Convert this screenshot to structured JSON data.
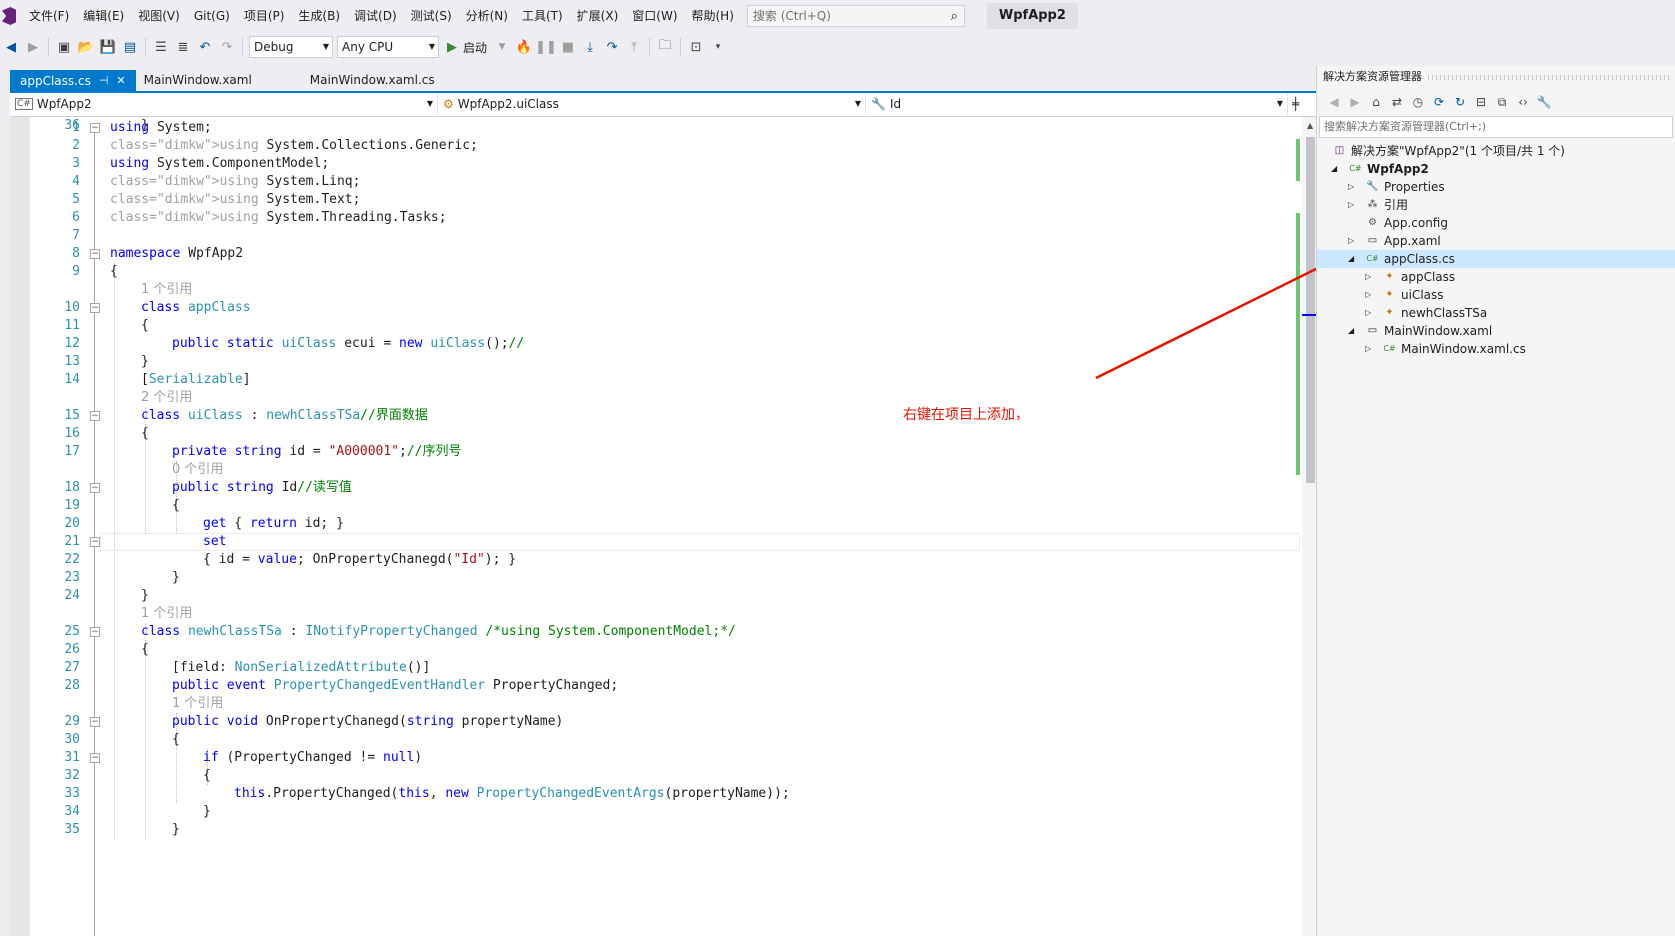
{
  "menu": {
    "items": [
      "文件(F)",
      "编辑(E)",
      "视图(V)",
      "Git(G)",
      "项目(P)",
      "生成(B)",
      "调试(D)",
      "测试(S)",
      "分析(N)",
      "工具(T)",
      "扩展(X)",
      "窗口(W)",
      "帮助(H)"
    ],
    "search_placeholder": "搜索 (Ctrl+Q)",
    "solution_badge": "WpfApp2"
  },
  "toolbar": {
    "config": "Debug",
    "platform": "Any CPU",
    "start_label": "启动"
  },
  "tabs": [
    {
      "label": "appClass.cs",
      "active": true
    },
    {
      "label": "MainWindow.xaml",
      "active": false
    },
    {
      "label": "MainWindow.xaml.cs",
      "active": false
    }
  ],
  "nav": {
    "project": "WpfApp2",
    "type": "WpfApp2.uiClass",
    "member": "Id"
  },
  "code": {
    "lines": [
      {
        "n": "1",
        "text": "using System;"
      },
      {
        "n": "2",
        "text": "using System.Collections.Generic;"
      },
      {
        "n": "3",
        "text": "using System.ComponentModel;"
      },
      {
        "n": "4",
        "text": "using System.Linq;"
      },
      {
        "n": "5",
        "text": "using System.Text;"
      },
      {
        "n": "6",
        "text": "using System.Threading.Tasks;"
      },
      {
        "n": "7",
        "text": ""
      },
      {
        "n": "8",
        "text": "namespace WpfApp2"
      },
      {
        "n": "9",
        "text": "{"
      },
      {
        "n": "10",
        "text": "class appClass"
      },
      {
        "n": "11",
        "text": "{"
      },
      {
        "n": "12",
        "text": "public static uiClass ecui = new uiClass();//"
      },
      {
        "n": "13",
        "text": "}"
      },
      {
        "n": "14",
        "text": "[Serializable]"
      },
      {
        "n": "15",
        "text": "class uiClass : newhClassTSa//界面数据"
      },
      {
        "n": "16",
        "text": "{"
      },
      {
        "n": "17",
        "text": "private string id = \"A000001\";//序列号"
      },
      {
        "n": "18",
        "text": "public string Id//读写值"
      },
      {
        "n": "19",
        "text": "{"
      },
      {
        "n": "20",
        "text": "get { return id; }"
      },
      {
        "n": "21",
        "text": "set"
      },
      {
        "n": "22",
        "text": "{ id = value; OnPropertyChanegd(\"Id\"); }"
      },
      {
        "n": "23",
        "text": "}"
      },
      {
        "n": "24",
        "text": "}"
      },
      {
        "n": "25",
        "text": "class newhClassTSa : INotifyPropertyChanged /*using System.ComponentModel;*/"
      },
      {
        "n": "26",
        "text": "{"
      },
      {
        "n": "27",
        "text": "[field: NonSerializedAttribute()]"
      },
      {
        "n": "28",
        "text": "public event PropertyChangedEventHandler PropertyChanged;"
      },
      {
        "n": "29",
        "text": "public void OnPropertyChanegd(string propertyName)"
      },
      {
        "n": "30",
        "text": "{"
      },
      {
        "n": "31",
        "text": "if (PropertyChanged != null)"
      },
      {
        "n": "32",
        "text": "{"
      },
      {
        "n": "33",
        "text": "this.PropertyChanged(this, new PropertyChangedEventArgs(propertyName));"
      },
      {
        "n": "34",
        "text": "}"
      },
      {
        "n": "35",
        "text": "}"
      },
      {
        "n": "36",
        "text": "}"
      }
    ],
    "codelens": [
      "1 个引用",
      "2 个引用",
      "0 个引用",
      "1 个引用",
      "1 个引用"
    ]
  },
  "annotation": "右键在项目上添加，",
  "solution_explorer": {
    "title": "解决方案资源管理器",
    "search_placeholder": "搜索解决方案资源管理器(Ctrl+;)",
    "tree": [
      {
        "label": "解决方案\"WpfApp2\"(1 个项目/共 1 个)",
        "icon": "solution-icon"
      },
      {
        "label": "WpfApp2",
        "icon": "csharp-project-icon"
      },
      {
        "label": "Properties",
        "icon": "wrench-icon"
      },
      {
        "label": "引用",
        "icon": "references-icon"
      },
      {
        "label": "App.config",
        "icon": "config-file-icon"
      },
      {
        "label": "App.xaml",
        "icon": "xaml-file-icon"
      },
      {
        "label": "appClass.cs",
        "icon": "csharp-file-icon"
      },
      {
        "label": "appClass",
        "icon": "class-icon"
      },
      {
        "label": "uiClass",
        "icon": "class-icon"
      },
      {
        "label": "newhClassTSa",
        "icon": "class-icon"
      },
      {
        "label": "MainWindow.xaml",
        "icon": "xaml-file-icon"
      },
      {
        "label": "MainWindow.xaml.cs",
        "icon": "csharp-file-icon"
      }
    ]
  },
  "colors": {
    "accent": "#007acc",
    "keyword": "#0000ff",
    "type": "#2b91af",
    "comment": "#008000",
    "string": "#a31515",
    "annotation": "#e51400"
  }
}
